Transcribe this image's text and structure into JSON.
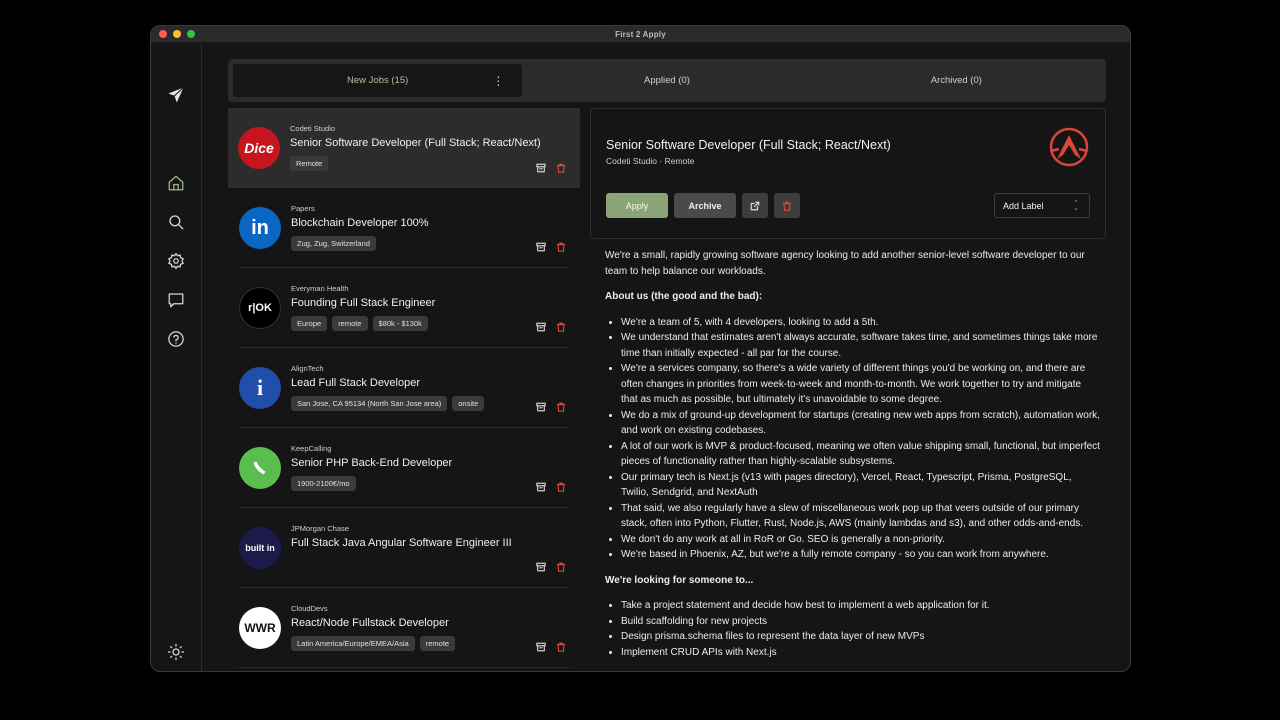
{
  "window": {
    "title": "First 2 Apply"
  },
  "tabs": [
    {
      "label": "New Jobs (15)",
      "active": true
    },
    {
      "label": "Applied (0)",
      "active": false
    },
    {
      "label": "Archived (0)",
      "active": false
    }
  ],
  "tab_menu_glyph": "⋮",
  "sidebar_icons": [
    "send-logo-icon",
    "home-icon",
    "search-icon",
    "settings-icon",
    "message-icon",
    "help-icon",
    "theme-sun-icon"
  ],
  "jobs": [
    {
      "company": "Codeti Studio",
      "title": "Senior Software Developer (Full Stack; React/Next)",
      "tags": [
        "Remote"
      ],
      "logo_text": "Dice",
      "selected": true
    },
    {
      "company": "Papers",
      "title": "Blockchain Developer 100%",
      "tags": [
        "Zug, Zug, Switzerland"
      ],
      "logo_text": "in"
    },
    {
      "company": "Everyman Health",
      "title": "Founding Full Stack Engineer",
      "tags": [
        "Europe",
        "remote",
        "$80k - $130k"
      ],
      "logo_text": "r|OK"
    },
    {
      "company": "AlignTech",
      "title": "Lead Full Stack Developer",
      "tags": [
        "San Jose, CA 95134 (North San Jose area)",
        "onsite"
      ],
      "logo_text": "i"
    },
    {
      "company": "KeepCalling",
      "title": "Senior PHP Back-End Developer",
      "tags": [
        "1900-2100€/mo"
      ],
      "logo_text": ""
    },
    {
      "company": "JPMorgan Chase",
      "title": "Full Stack Java Angular Software Engineer III",
      "tags": [],
      "logo_text": "built in"
    },
    {
      "company": "CloudDevs",
      "title": "React/Node Fullstack Developer",
      "tags": [
        "Latin America/Europe/EMEA/Asia",
        "remote"
      ],
      "logo_text": "WWR"
    }
  ],
  "detail": {
    "title": "Senior Software Developer (Full Stack; React/Next)",
    "subtitle": "Codeti Studio · Remote",
    "apply_label": "Apply",
    "archive_label": "Archive",
    "label_select": "Add Label",
    "intro": "We're a small, rapidly growing software agency looking to add another senior-level software developer to our team to help balance our workloads.",
    "about_heading": "About us (the good and the bad):",
    "about_items": [
      "We're a team of 5, with 4 developers, looking to add a 5th.",
      "We understand that estimates aren't always accurate, software takes time, and sometimes things take more time than initially expected - all par for the course.",
      "We're a services company, so there's a wide variety of different things you'd be working on, and there are often changes in priorities from week-to-week and month-to-month. We work together to try and mitigate that as much as possible, but ultimately it's unavoidable to some degree.",
      "We do a mix of ground-up development for startups (creating new web apps from scratch), automation work, and work on existing codebases.",
      "A lot of our work is MVP & product-focused, meaning we often value shipping small, functional, but imperfect pieces of functionality rather than highly-scalable subsystems.",
      "Our primary tech is Next.js (v13 with pages directory), Vercel, React, Typescript, Prisma, PostgreSQL, Twilio, Sendgrid, and NextAuth",
      "That said, we also regularly have a slew of miscellaneous work pop up that veers outside of our primary stack, often into Python, Flutter, Rust, Node.js, AWS (mainly lambdas and s3), and other odds-and-ends.",
      "We don't do any work at all in RoR or Go. SEO is generally a non-priority.",
      "We're based in Phoenix, AZ, but we're a fully remote company - so you can work from anywhere."
    ],
    "looking_heading": "We're looking for someone to...",
    "looking_items": [
      "Take a project statement and decide how best to implement a web application for it.",
      "Build scaffolding for new projects",
      "Design prisma.schema files to represent the data layer of new MVPs",
      "Implement CRUD APIs with Next.js"
    ]
  }
}
